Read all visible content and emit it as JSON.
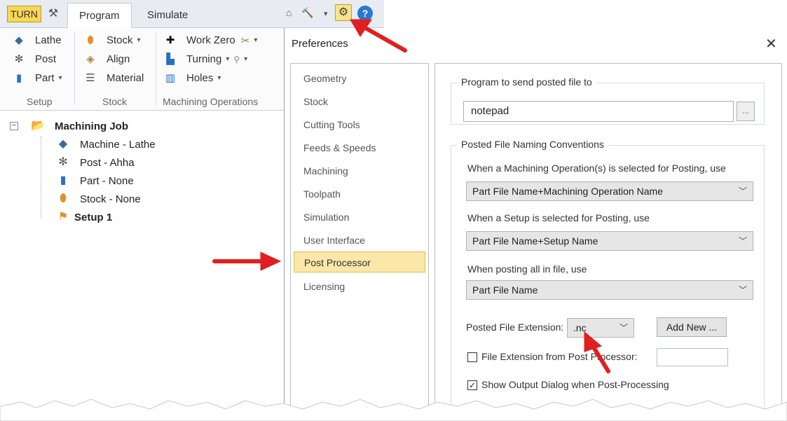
{
  "titlebar": {
    "turn_badge": "TURN",
    "tabs": [
      "Program",
      "Simulate"
    ],
    "active_tab": "Program",
    "caret": "▾"
  },
  "ribbon": {
    "setup": {
      "items": [
        "Lathe",
        "Post",
        "Part"
      ],
      "label": "Setup"
    },
    "stock": {
      "items": [
        "Stock",
        "Align",
        "Material"
      ],
      "label": "Stock"
    },
    "machining": {
      "items": [
        "Work Zero",
        "Turning",
        "Holes"
      ],
      "label": "Machining Operations"
    }
  },
  "tree": {
    "root": "Machining Job",
    "children": [
      "Machine - Lathe",
      "Post - Ahha",
      "Part - None",
      "Stock - None",
      "Setup 1"
    ]
  },
  "dialog": {
    "title": "Preferences",
    "close": "✕",
    "nav": [
      "Geometry",
      "Stock",
      "Cutting Tools",
      "Feeds & Speeds",
      "Machining",
      "Toolpath",
      "Simulation",
      "User Interface",
      "Post Processor",
      "Licensing"
    ],
    "selected_nav": "Post Processor",
    "program_group": "Program to send posted file to",
    "program_value": "notepad",
    "browse_label": "...",
    "naming_group": "Posted File Naming Conventions",
    "op_label": "When a Machining Operation(s) is selected for Posting, use",
    "op_value": "Part File Name+Machining Operation Name",
    "setup_label": "When a Setup is selected for Posting, use",
    "setup_value": "Part File Name+Setup Name",
    "all_label": "When posting all in file, use",
    "all_value": "Part File Name",
    "ext_label": "Posted File Extension:",
    "ext_value": ".nc",
    "add_new": "Add New ...",
    "ext_from_post": {
      "label": "File Extension from Post Processor:",
      "checked": false
    },
    "show_output": {
      "label": "Show Output Dialog when Post-Processing",
      "checked": true
    },
    "check_mark": "✓"
  },
  "colors": {
    "selected_nav_bg": "#fbe7a8",
    "turn_badge_bg": "#f7d656",
    "arrow": "#e02020"
  }
}
